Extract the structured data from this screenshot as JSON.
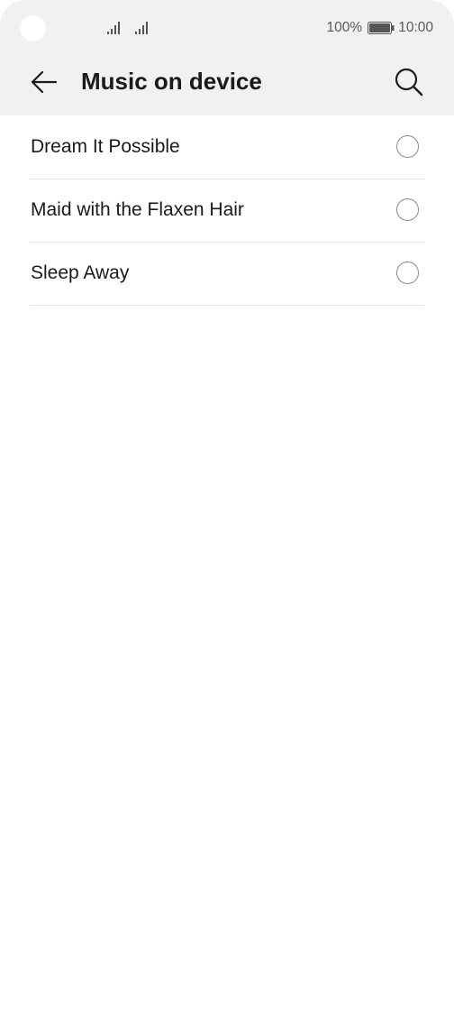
{
  "status_bar": {
    "battery_percent": "100%",
    "time": "10:00",
    "icons": [
      "signal-icon",
      "signal-icon",
      "battery-icon"
    ]
  },
  "app_bar": {
    "title": "Music on device",
    "back_icon": "back-arrow-icon",
    "search_icon": "search-icon"
  },
  "songs": [
    {
      "title": "Dream It Possible",
      "selected": false
    },
    {
      "title": "Maid with the Flaxen Hair",
      "selected": false
    },
    {
      "title": "Sleep Away",
      "selected": false
    }
  ],
  "colors": {
    "header_bg": "#f1f1f1",
    "text": "#1a1a1a",
    "divider": "#e3e3e3",
    "radio_border": "#8a8a8a"
  }
}
